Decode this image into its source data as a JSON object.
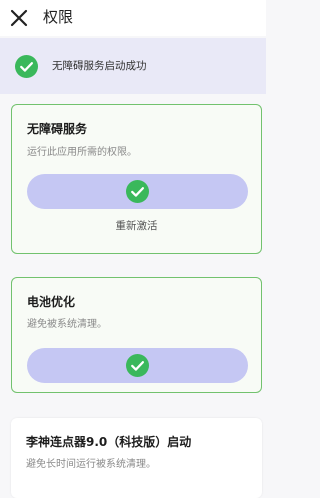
{
  "header": {
    "title": "权限",
    "close_icon": "close-icon"
  },
  "banner": {
    "icon": "check-circle-icon",
    "text": "无障碍服务启动成功"
  },
  "cards": [
    {
      "title": "无障碍服务",
      "description": "运行此应用所需的权限。",
      "status_icon": "check-circle-icon",
      "action_label": "重新激活"
    },
    {
      "title": "电池优化",
      "description": "避免被系统清理。",
      "status_icon": "check-circle-icon"
    },
    {
      "title": "李神连点器9.0（科技版）启动",
      "description": "避免长时间运行被系统清理。"
    }
  ],
  "colors": {
    "success": "#3ab85b",
    "card_border": "#72c26e",
    "pill": "#c5c7f3",
    "banner_bg": "#e9e9f7"
  }
}
